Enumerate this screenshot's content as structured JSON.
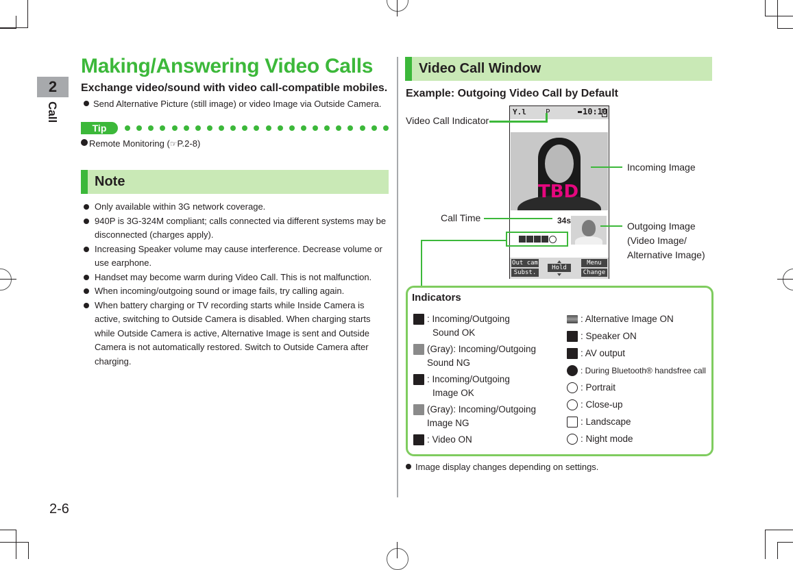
{
  "page": {
    "chapter_number": "2",
    "chapter_label": "Call",
    "page_number": "2-6"
  },
  "left": {
    "title": "Making/Answering Video Calls",
    "subtitle": "Exchange video/sound with video call-compatible mobiles.",
    "intro_bullet": "Send Alternative Picture (still image) or video Image via Outside Camera.",
    "tip": {
      "label": "Tip",
      "item_text": "Remote Monitoring (",
      "ref_icon": "pointing-hand-icon",
      "ref_page": "P.2-8)"
    },
    "note": {
      "heading": "Note",
      "items": [
        "Only available within 3G network coverage.",
        "940P is 3G-324M compliant; calls connected via different systems may be disconnected (charges apply).",
        "Increasing Speaker volume may cause interference. Decrease volume or use earphone.",
        "Handset may become warm during Video Call. This is not malfunction.",
        "When incoming/outgoing sound or image fails, try calling again.",
        "When battery charging or TV recording starts while Inside Camera is active, switching to Outside Camera is disabled. When charging starts while Outside Camera is active, Alternative Image is sent and Outside Camera is not automatically restored. Switch to Outside Camera after charging."
      ]
    }
  },
  "right": {
    "heading": "Video Call Window",
    "example_title": "Example: Outgoing Video Call by Default",
    "callouts": {
      "video_call_indicator": "Video Call Indicator",
      "incoming_image": "Incoming Image",
      "call_time": "Call Time",
      "outgoing_image_line1": "Outgoing Image",
      "outgoing_image_line2": "(Video Image/",
      "outgoing_image_line3": "Alternative Image)"
    },
    "phone_screen": {
      "status_signal": "Y.l",
      "status_indicator": "P",
      "status_time": "10:10",
      "placeholder_text": "TBD",
      "call_time": "34s",
      "softkeys": {
        "top_left": "Out cam",
        "bottom_left": "Subst.",
        "center": "Hold",
        "top_right": "Menu",
        "bottom_right": "Change"
      }
    },
    "indicators": {
      "title": "Indicators",
      "left_column": [
        {
          "icon": "sound-ok-icon",
          "tone": "dark",
          "line1": ": Incoming/Outgoing",
          "line2": "Sound OK"
        },
        {
          "icon": "sound-ng-icon",
          "tone": "gray",
          "line1": "(Gray): Incoming/Outgoing",
          "line2": "Sound NG"
        },
        {
          "icon": "image-ok-icon",
          "tone": "dark",
          "line1": ": Incoming/Outgoing",
          "line2": "Image OK"
        },
        {
          "icon": "image-ng-icon",
          "tone": "gray",
          "line1": "(Gray): Incoming/Outgoing",
          "line2": "Image NG"
        },
        {
          "icon": "video-on-icon",
          "tone": "dark",
          "line1": ": Video ON",
          "line2": ""
        }
      ],
      "right_column": [
        {
          "icon": "alternative-image-icon",
          "text": ": Alternative Image ON"
        },
        {
          "icon": "speaker-on-icon",
          "text": ": Speaker ON"
        },
        {
          "icon": "av-output-icon",
          "text": ": AV output"
        },
        {
          "icon": "bluetooth-icon",
          "text": ": During Bluetooth® handsfree call"
        },
        {
          "icon": "portrait-icon",
          "text": ": Portrait"
        },
        {
          "icon": "close-up-icon",
          "text": ": Close-up"
        },
        {
          "icon": "landscape-icon",
          "text": ": Landscape"
        },
        {
          "icon": "night-mode-icon",
          "text": ": Night mode"
        }
      ]
    },
    "final_note": "Image display changes depending on settings."
  },
  "colors": {
    "accent_green": "#3cb83a",
    "section_bg": "#c9e9b6",
    "box_border": "#7fcc5f",
    "chapter_tab": "#a7a9ac",
    "tbd_magenta": "#e5077e"
  }
}
